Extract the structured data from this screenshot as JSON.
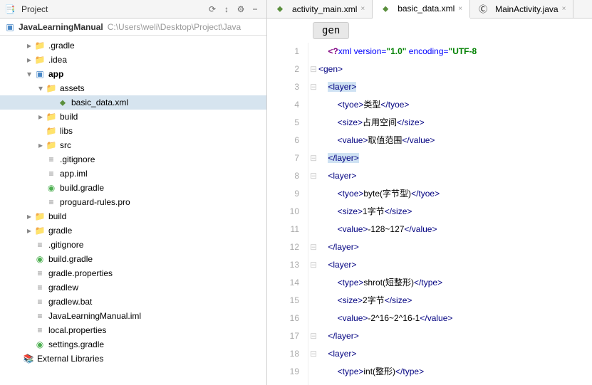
{
  "header": {
    "title": "Project"
  },
  "project": {
    "root": "JavaLearningManual",
    "path": "C:\\Users\\weli\\Desktop\\Project\\Java"
  },
  "tree": [
    {
      "d": 0,
      "a": "r",
      "i": "dir",
      "t": ".gradle"
    },
    {
      "d": 0,
      "a": "r",
      "i": "dir",
      "t": ".idea"
    },
    {
      "d": 0,
      "a": "d",
      "i": "app-mod",
      "t": "app",
      "b": true
    },
    {
      "d": 1,
      "a": "d",
      "i": "dir",
      "t": "assets"
    },
    {
      "d": 2,
      "a": "n",
      "i": "xml-f",
      "t": "basic_data.xml",
      "sel": true
    },
    {
      "d": 1,
      "a": "r",
      "i": "dir",
      "t": "build"
    },
    {
      "d": 1,
      "a": "n",
      "i": "dir",
      "t": "libs"
    },
    {
      "d": 1,
      "a": "r",
      "i": "dir",
      "t": "src"
    },
    {
      "d": 1,
      "a": "n",
      "i": "txt-f",
      "t": ".gitignore"
    },
    {
      "d": 1,
      "a": "n",
      "i": "txt-f",
      "t": "app.iml"
    },
    {
      "d": 1,
      "a": "n",
      "i": "gradle-f",
      "t": "build.gradle"
    },
    {
      "d": 1,
      "a": "n",
      "i": "txt-f",
      "t": "proguard-rules.pro"
    },
    {
      "d": 0,
      "a": "r",
      "i": "dir",
      "t": "build"
    },
    {
      "d": 0,
      "a": "r",
      "i": "dir",
      "t": "gradle"
    },
    {
      "d": 0,
      "a": "n",
      "i": "txt-f",
      "t": ".gitignore"
    },
    {
      "d": 0,
      "a": "n",
      "i": "gradle-f",
      "t": "build.gradle"
    },
    {
      "d": 0,
      "a": "n",
      "i": "txt-f",
      "t": "gradle.properties"
    },
    {
      "d": 0,
      "a": "n",
      "i": "txt-f",
      "t": "gradlew"
    },
    {
      "d": 0,
      "a": "n",
      "i": "txt-f",
      "t": "gradlew.bat"
    },
    {
      "d": 0,
      "a": "n",
      "i": "txt-f",
      "t": "JavaLearningManual.iml"
    },
    {
      "d": 0,
      "a": "n",
      "i": "txt-f",
      "t": "local.properties"
    },
    {
      "d": 0,
      "a": "n",
      "i": "gradle-f",
      "t": "settings.gradle"
    },
    {
      "d": -1,
      "a": "n",
      "i": "lib-ico",
      "t": "External Libraries"
    }
  ],
  "tabs": [
    {
      "ico": "xml-f",
      "label": "activity_main.xml",
      "active": false
    },
    {
      "ico": "xml-f",
      "label": "basic_data.xml",
      "active": true
    },
    {
      "ico": "java-f",
      "label": "MainActivity.java",
      "active": false
    }
  ],
  "crumb": "gen",
  "code": [
    {
      "n": 1,
      "f": "",
      "h": "    <span class='pi'>&lt;?</span><span class='attr'>xml version=</span><span class='str'>\"1.0\"</span> <span class='attr'>encoding=</span><span class='str'>\"UTF-8</span>"
    },
    {
      "n": 2,
      "f": "⊟",
      "h": "<span class='tag'>&lt;gen&gt;</span>"
    },
    {
      "n": 3,
      "f": "⊟",
      "h": "    <span class='hl'><span class='tag'>&lt;layer&gt;</span></span>"
    },
    {
      "n": 4,
      "f": "",
      "h": "        <span class='tag'>&lt;tyoe&gt;</span><span class='txt'>类型</span><span class='tag'>&lt;/tyoe&gt;</span>"
    },
    {
      "n": 5,
      "f": "",
      "h": "        <span class='tag'>&lt;size&gt;</span><span class='txt'>占用空间</span><span class='tag'>&lt;/size&gt;</span>"
    },
    {
      "n": 6,
      "f": "",
      "h": "        <span class='tag'>&lt;value&gt;</span><span class='txt'>取值范围</span><span class='tag'>&lt;/value&gt;</span>"
    },
    {
      "n": 7,
      "f": "⊟",
      "h": "    <span class='hl'><span class='tag'>&lt;/layer&gt;</span></span>"
    },
    {
      "n": 8,
      "f": "⊟",
      "h": "    <span class='tag'>&lt;layer&gt;</span>"
    },
    {
      "n": 9,
      "f": "",
      "h": "        <span class='tag'>&lt;tyoe&gt;</span><span class='txt'>byte(字节型)</span><span class='tag'>&lt;/tyoe&gt;</span>"
    },
    {
      "n": 10,
      "f": "",
      "h": "        <span class='tag'>&lt;size&gt;</span><span class='txt'>1字节</span><span class='tag'>&lt;/size&gt;</span>"
    },
    {
      "n": 11,
      "f": "",
      "h": "        <span class='tag'>&lt;value&gt;</span><span class='txt'>-128~127</span><span class='tag'>&lt;/value&gt;</span>"
    },
    {
      "n": 12,
      "f": "⊟",
      "h": "    <span class='tag'>&lt;/layer&gt;</span>"
    },
    {
      "n": 13,
      "f": "⊟",
      "h": "    <span class='tag'>&lt;layer&gt;</span>"
    },
    {
      "n": 14,
      "f": "",
      "h": "        <span class='tag'>&lt;type&gt;</span><span class='txt'>shrot(短整形)</span><span class='tag'>&lt;/type&gt;</span>"
    },
    {
      "n": 15,
      "f": "",
      "h": "        <span class='tag'>&lt;size&gt;</span><span class='txt'>2字节</span><span class='tag'>&lt;/size&gt;</span>"
    },
    {
      "n": 16,
      "f": "",
      "h": "        <span class='tag'>&lt;value&gt;</span><span class='txt'>-2^16~2^16-1</span><span class='tag'>&lt;/value&gt;</span>"
    },
    {
      "n": 17,
      "f": "⊟",
      "h": "    <span class='tag'>&lt;/layer&gt;</span>"
    },
    {
      "n": 18,
      "f": "⊟",
      "h": "    <span class='tag'>&lt;layer&gt;</span>"
    },
    {
      "n": 19,
      "f": "",
      "h": "        <span class='tag'>&lt;type&gt;</span><span class='txt'>int(整形)</span><span class='tag'>&lt;/type&gt;</span>"
    }
  ]
}
